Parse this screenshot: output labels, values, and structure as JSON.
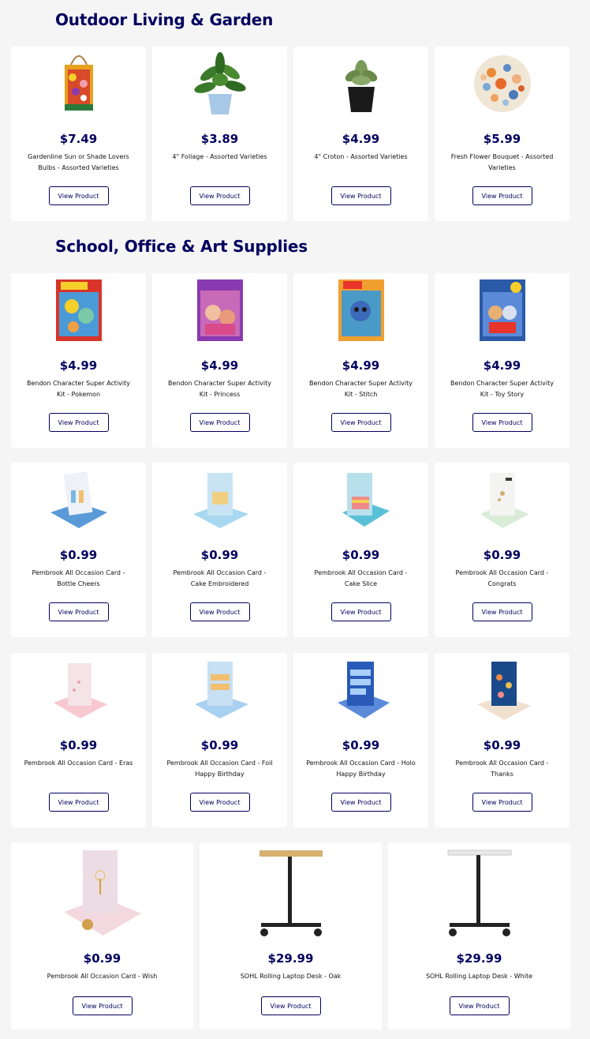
{
  "sections": [
    {
      "title": "Outdoor Living & Garden"
    },
    {
      "title": "School, Office & Art Supplies"
    }
  ],
  "button_label": "View Product",
  "garden": [
    {
      "price": "$7.49",
      "name": "Gardenline Sun or Shade Lovers Bulbs - Assorted Varieties",
      "icon": "bulb-bag-image"
    },
    {
      "price": "$3.89",
      "name": "4\" Foliage - Assorted Varieties",
      "icon": "foliage-plant-image"
    },
    {
      "price": "$4.99",
      "name": "4\" Croton - Assorted Varieties",
      "icon": "croton-plant-image"
    },
    {
      "price": "$5.99",
      "name": "Fresh Flower Bouquet - Assorted Varieties",
      "icon": "flower-bouquet-image"
    }
  ],
  "supplies_row1": [
    {
      "price": "$4.99",
      "name": "Bendon Character Super Activity Kit - Pokemon"
    },
    {
      "price": "$4.99",
      "name": "Bendon Character Super Activity Kit - Princess"
    },
    {
      "price": "$4.99",
      "name": "Bendon Character Super Activity Kit - Stitch"
    },
    {
      "price": "$4.99",
      "name": "Bendon Character Super Activity Kit - Toy Story"
    }
  ],
  "supplies_row2": [
    {
      "price": "$0.99",
      "name": "Pembrook All Occasion Card - Bottle Cheers"
    },
    {
      "price": "$0.99",
      "name": "Pembrook All Occasion Card - Cake Embroidered"
    },
    {
      "price": "$0.99",
      "name": "Pembrook All Occasion Card - Cake Slice"
    },
    {
      "price": "$0.99",
      "name": "Pembrook All Occasion Card - Congrats"
    }
  ],
  "supplies_row3": [
    {
      "price": "$0.99",
      "name": "Pembrook All Occasion Card - Eras"
    },
    {
      "price": "$0.99",
      "name": "Pembrook All Occasion Card - Foil Happy Birthday"
    },
    {
      "price": "$0.99",
      "name": "Pembrook All Occasion Card - Holo Happy Birthday"
    },
    {
      "price": "$0.99",
      "name": "Pembrook All Occasion Card - Thanks"
    }
  ],
  "supplies_row4": [
    {
      "price": "$0.99",
      "name": "Pembrook All Occasion Card - Wish"
    },
    {
      "price": "$29.99",
      "name": "SOHL Rolling Laptop Desk - Oak"
    },
    {
      "price": "$29.99",
      "name": "SOHL Rolling Laptop Desk - White"
    }
  ],
  "colors": {
    "brand_navy": "#00005f",
    "page_bg": "#f5f5f5",
    "card_bg": "#ffffff"
  }
}
